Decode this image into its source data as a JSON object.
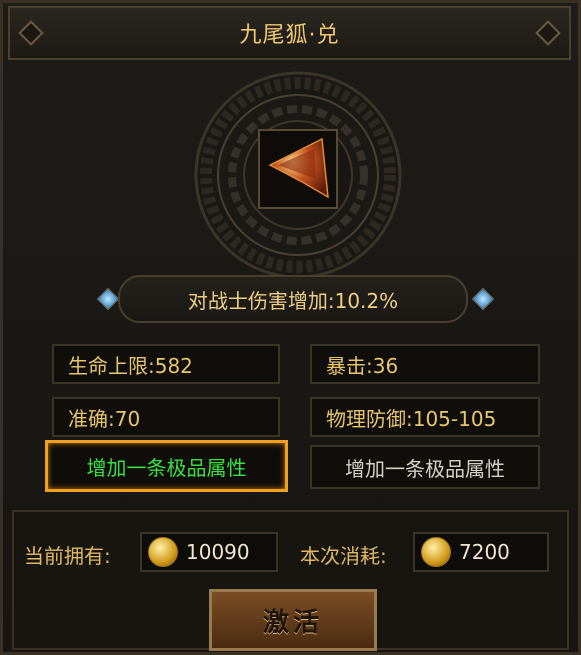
{
  "title": "九尾狐·兑",
  "item": {
    "icon": "flame-shard-icon"
  },
  "main_attribute": "对战士伤害增加:10.2%",
  "attributes": [
    "生命上限:582",
    "暴击:36",
    "准确:70",
    "物理防御:105-105"
  ],
  "options": {
    "left_label": "增加一条极品属性",
    "right_label": "增加一条极品属性"
  },
  "cost": {
    "owned_label": "当前拥有:",
    "owned_value": "10090",
    "consume_label": "本次消耗:",
    "consume_value": "7200",
    "currency_icon": "gold-coin-icon"
  },
  "activate_label": "激活",
  "colors": {
    "gold_text": "#f0c872",
    "active_option": "#39e041",
    "active_border": "#f0a21e"
  }
}
